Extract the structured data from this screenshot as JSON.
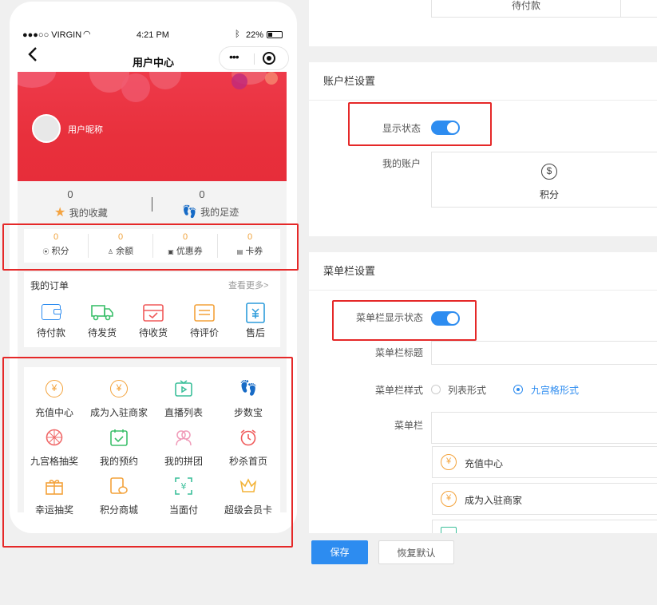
{
  "phone": {
    "status": {
      "carrier": "●●●○○ VIRGIN",
      "time": "4:21 PM",
      "battery": "22%"
    },
    "nav": {
      "title": "用户中心"
    },
    "profile": {
      "nickname": "用户昵称"
    },
    "stats": [
      {
        "value": "0",
        "label": "我的收藏",
        "icon": "star-icon"
      },
      {
        "value": "0",
        "label": "我的足迹",
        "icon": "footprint-icon"
      }
    ],
    "assets": [
      {
        "value": "0",
        "label": "积分",
        "icon": "points-icon"
      },
      {
        "value": "0",
        "label": "余额",
        "icon": "balance-icon"
      },
      {
        "value": "0",
        "label": "优惠券",
        "icon": "coupon-icon"
      },
      {
        "value": "0",
        "label": "卡券",
        "icon": "card-icon"
      }
    ],
    "orders": {
      "title": "我的订单",
      "more": "查看更多>",
      "items": [
        {
          "label": "待付款",
          "icon": "wallet-icon"
        },
        {
          "label": "待发货",
          "icon": "truck-icon"
        },
        {
          "label": "待收货",
          "icon": "inbox-icon"
        },
        {
          "label": "待评价",
          "icon": "comment-icon"
        },
        {
          "label": "售后",
          "icon": "aftersale-icon"
        }
      ]
    },
    "menu_grid": [
      {
        "label": "充值中心",
        "icon": "yuan-sack-icon"
      },
      {
        "label": "成为入驻商家",
        "icon": "yuan-sack-icon"
      },
      {
        "label": "直播列表",
        "icon": "tv-icon"
      },
      {
        "label": "步数宝",
        "icon": "footprint-icon"
      },
      {
        "label": "九宫格抽奖",
        "icon": "wheel-icon"
      },
      {
        "label": "我的预约",
        "icon": "calendar-check-icon"
      },
      {
        "label": "我的拼团",
        "icon": "group-icon"
      },
      {
        "label": "秒杀首页",
        "icon": "alarm-icon"
      },
      {
        "label": "幸运抽奖",
        "icon": "gift-icon"
      },
      {
        "label": "积分商城",
        "icon": "points-mall-icon"
      },
      {
        "label": "当面付",
        "icon": "scan-pay-icon"
      },
      {
        "label": "超级会员卡",
        "icon": "crown-icon"
      }
    ]
  },
  "settings": {
    "top_cell": "待付款",
    "account_bar": {
      "title": "账户栏设置",
      "display_label": "显示状态",
      "my_account_label": "我的账户",
      "account_item": "积分"
    },
    "menu_bar": {
      "title": "菜单栏设置",
      "display_label": "菜单栏显示状态",
      "title_label": "菜单栏标题",
      "style_label": "菜单栏样式",
      "style_options": [
        "列表形式",
        "九宫格形式"
      ],
      "selected_style": "九宫格形式",
      "menu_label": "菜单栏",
      "menu_items": [
        "充值中心",
        "成为入驻商家"
      ]
    },
    "buttons": {
      "save": "保存",
      "reset": "恢复默认"
    }
  },
  "colors": {
    "accent": "#2d8cf0",
    "hero_red": "#e8303c",
    "highlight_red": "#e52828",
    "asset_orange": "#f0a23b"
  }
}
